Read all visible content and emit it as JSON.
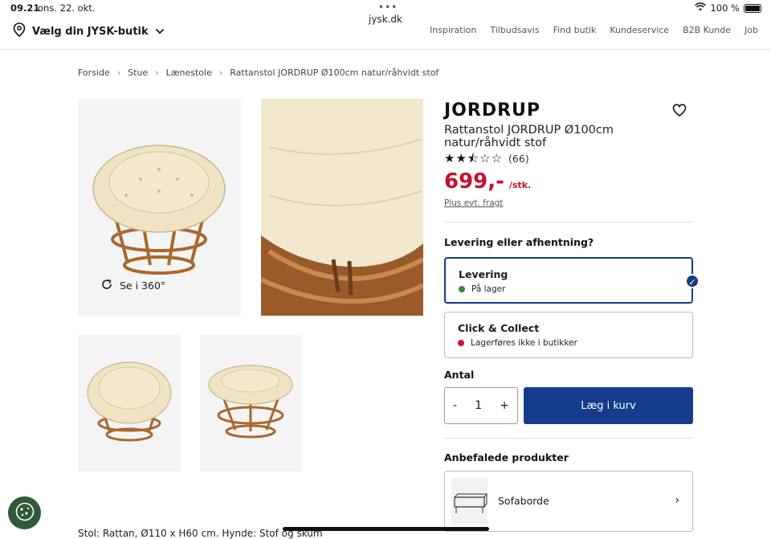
{
  "status_bar": {
    "time": "09.21",
    "date": "ons. 22. okt.",
    "url": "jysk.dk",
    "battery": "100 %"
  },
  "topnav": {
    "store_picker": "Vælg din JYSK-butik",
    "links": [
      "Inspiration",
      "Tilbudsavis",
      "Find butik",
      "Kundeservice",
      "B2B Kunde",
      "Job"
    ]
  },
  "breadcrumb": [
    "Forside",
    "Stue",
    "Lænestole",
    "Rattanstol JORDRUP Ø100cm natur/råhvidt stof"
  ],
  "gallery": {
    "see_360": "Se i 360°"
  },
  "product": {
    "brand": "JORDRUP",
    "name": "Rattanstol JORDRUP Ø100cm natur/råhvidt stof",
    "rating": 2.5,
    "rating_max": 5,
    "reviews": "(66)",
    "price": "699,-",
    "unit": "/stk.",
    "freight": "Plus evt. fragt",
    "description": "Stol: Rattan, Ø110 x H60 cm. Hynde: Stof og skum"
  },
  "delivery": {
    "heading": "Levering eller afhentning?",
    "options": [
      {
        "title": "Levering",
        "status": "På lager",
        "status_color": "#2e8b3a",
        "selected": true
      },
      {
        "title": "Click & Collect",
        "status": "Lagerføres ikke i butikker",
        "status_color": "#c8102e",
        "selected": false
      }
    ]
  },
  "quantity": {
    "heading": "Antal",
    "minus": "-",
    "value": "1",
    "plus": "+"
  },
  "cart": {
    "add_label": "Læg i kurv"
  },
  "recommended": {
    "heading": "Anbefalede produkter",
    "item": "Sofaborde"
  },
  "colors": {
    "brand_blue": "#143c8a",
    "price_red": "#c8102e",
    "cookie_green": "#2f5a38"
  }
}
